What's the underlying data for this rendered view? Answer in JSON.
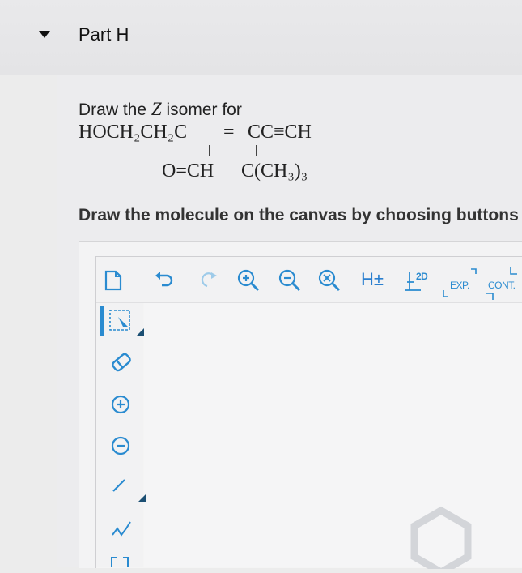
{
  "part": {
    "title": "Part H"
  },
  "question": {
    "prompt_prefix": "Draw the ",
    "prompt_var": "Z",
    "prompt_suffix": " isomer for",
    "formula_line1_left": "HOCH₂CH₂C",
    "formula_line1_eq": "=",
    "formula_line1_right": "CC≡CH",
    "formula_line2_left": "O=CH",
    "formula_line2_right": "C(CH₃)₃"
  },
  "instructions": "Draw the molecule on the canvas by choosing buttons from the Tools (for bonds), Atoms, and Advanced Template toolbars.",
  "toolbar": {
    "h_toggle": "H±",
    "label_2d": "2D",
    "exp": "EXP.",
    "cont": "CONT."
  },
  "colors": {
    "accent": "#2a8bd0",
    "header_bg": "#e6e6e8"
  }
}
